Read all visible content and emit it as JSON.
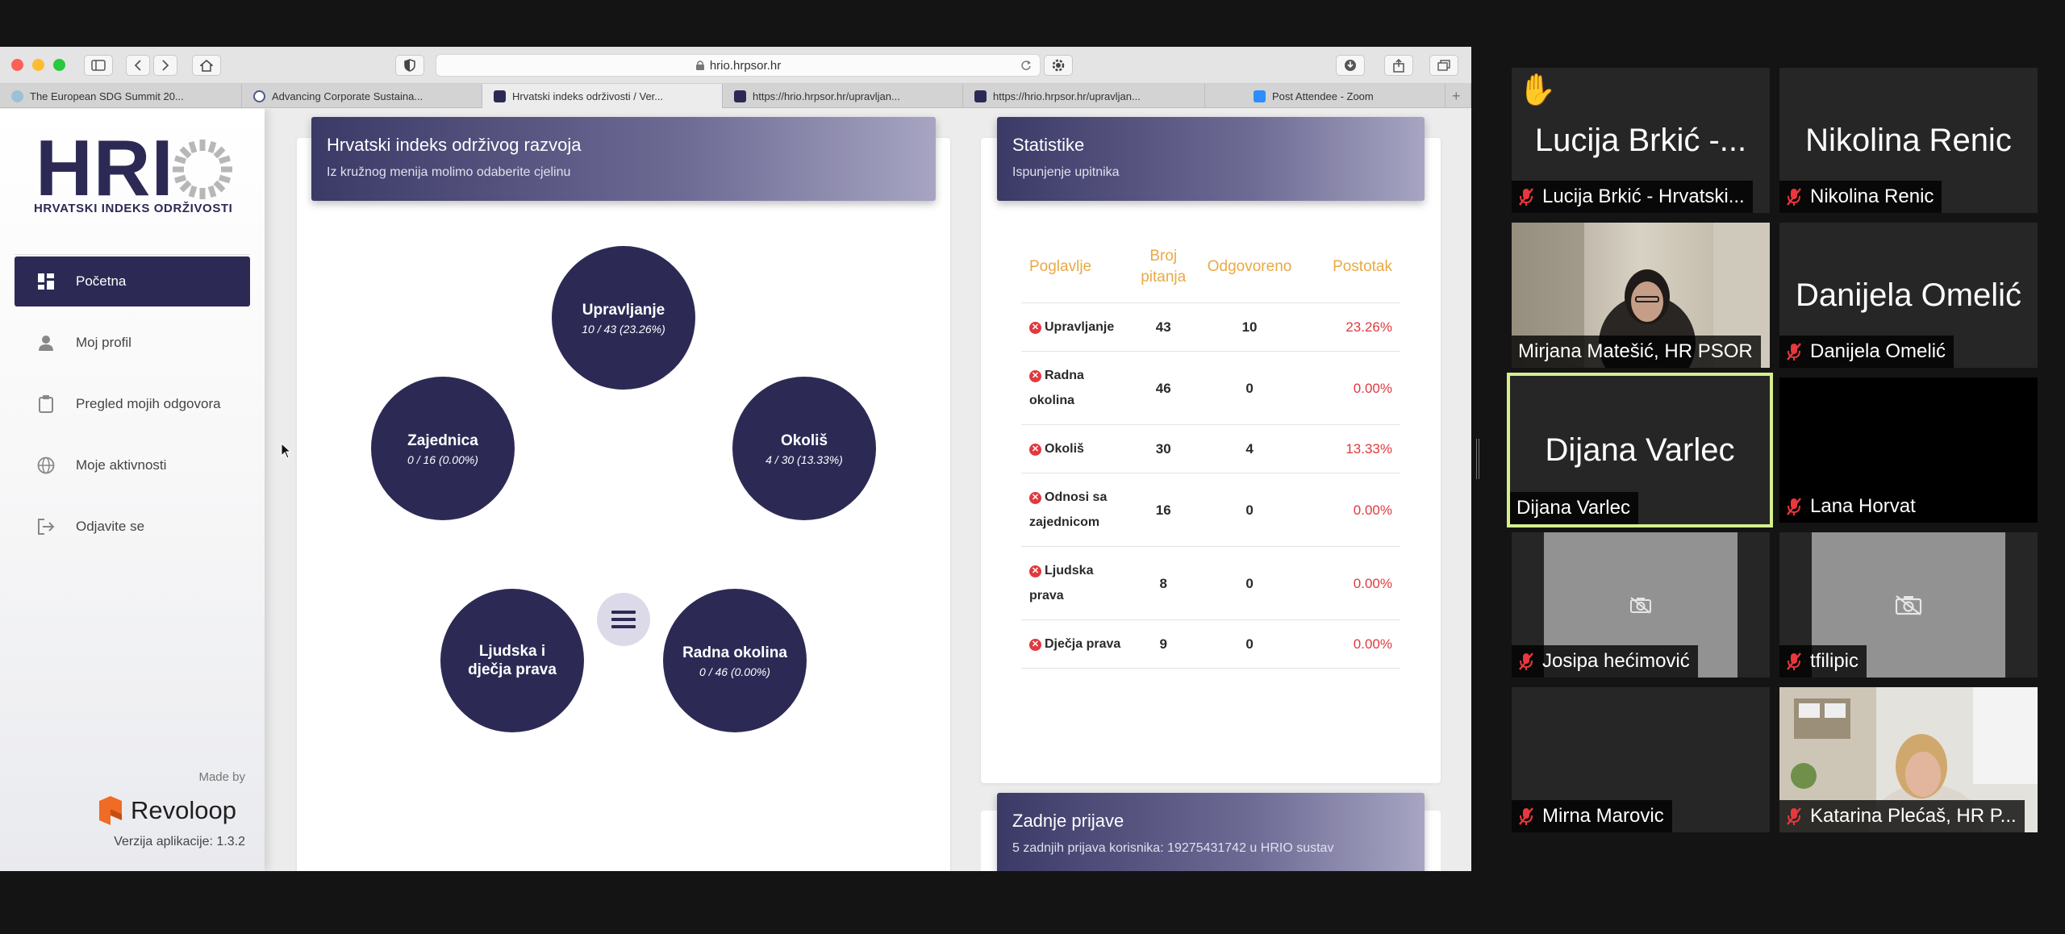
{
  "browser": {
    "url": "hrio.hrpsor.hr",
    "tabs": [
      {
        "label": "The European SDG Summit 20...",
        "active": false
      },
      {
        "label": "Advancing Corporate Sustaina...",
        "active": false
      },
      {
        "label": "Hrvatski indeks održivosti / Ver...",
        "active": true
      },
      {
        "label": "https://hrio.hrpsor.hr/upravljan...",
        "active": false
      },
      {
        "label": "https://hrio.hrpsor.hr/upravljan...",
        "active": false
      },
      {
        "label": "Post Attendee - Zoom",
        "active": false
      }
    ],
    "new_tab": "+"
  },
  "sidebar": {
    "logo_text": "HRI",
    "logo_subtitle": "HRVATSKI INDEKS ODRŽIVOSTI",
    "items": [
      {
        "label": "Početna",
        "icon": "dashboard-icon",
        "active": true
      },
      {
        "label": "Moj profil",
        "icon": "user-icon",
        "active": false
      },
      {
        "label": "Pregled mojih odgovora",
        "icon": "clipboard-icon",
        "active": false
      },
      {
        "label": "Moje aktivnosti",
        "icon": "globe-icon",
        "active": false
      },
      {
        "label": "Odjavite se",
        "icon": "logout-icon",
        "active": false
      }
    ],
    "made_by": "Made by",
    "brand": "Revoloop",
    "version": "Verzija aplikacije: 1.3.2"
  },
  "main": {
    "title": "Hrvatski indeks održivog razvoja",
    "subtitle": "Iz kružnog menija molimo odaberite cjelinu",
    "circles": [
      {
        "name": "Upravljanje",
        "value": "10 / 43 (23.26%)"
      },
      {
        "name": "Okoliš",
        "value": "4 / 30 (13.33%)"
      },
      {
        "name": "Radna okolina",
        "value": "0 / 46 (0.00%)"
      },
      {
        "name": "Ljudska i\ndječja prava",
        "value": ""
      },
      {
        "name": "Zajednica",
        "value": "0 / 16 (0.00%)"
      }
    ]
  },
  "stats": {
    "title": "Statistike",
    "subtitle": "Ispunjenje upitnika",
    "columns": [
      "Poglavlje",
      "Broj\npitanja",
      "Odgovoreno",
      "Postotak"
    ],
    "rows": [
      {
        "name": "Upravljanje",
        "count": "43",
        "answered": "10",
        "pct": "23.26%"
      },
      {
        "name": "Radna\nokolina",
        "count": "46",
        "answered": "0",
        "pct": "0.00%"
      },
      {
        "name": "Okoliš",
        "count": "30",
        "answered": "4",
        "pct": "13.33%"
      },
      {
        "name": "Odnosi sa\nzajednicom",
        "count": "16",
        "answered": "0",
        "pct": "0.00%"
      },
      {
        "name": "Ljudska\nprava",
        "count": "8",
        "answered": "0",
        "pct": "0.00%"
      },
      {
        "name": "Dječja prava",
        "count": "9",
        "answered": "0",
        "pct": "0.00%"
      }
    ]
  },
  "logins": {
    "title": "Zadnje prijave",
    "subtitle": "5 zadnjih prijava korisnika: 19275431742 u HRIO sustav"
  },
  "participants": [
    {
      "big": "Lucija Brkić -...",
      "label": "Lucija Brkić - Hrvatski...",
      "muted": true,
      "hand": "✋"
    },
    {
      "big": "Nikolina Renic",
      "label": "Nikolina Renic",
      "muted": true
    },
    {
      "big": "",
      "label": "Mirjana Matešić, HR PSOR",
      "muted": false,
      "video": true
    },
    {
      "big": "Danijela Omelić",
      "label": "Danijela Omelić",
      "muted": true
    },
    {
      "big": "Dijana Varlec",
      "label": "Dijana Varlec",
      "muted": false,
      "speaking": true
    },
    {
      "big": "",
      "label": "Lana Horvat",
      "muted": true
    },
    {
      "big": "",
      "label": "Josipa hećimović",
      "muted": true,
      "camoff": true
    },
    {
      "big": "",
      "label": "tfilipic",
      "muted": true,
      "camoff": true
    },
    {
      "big": "",
      "label": "Mirna Marovic",
      "muted": true
    },
    {
      "big": "",
      "label": "Katarina Plećaš, HR P...",
      "muted": true,
      "video": true
    }
  ]
}
